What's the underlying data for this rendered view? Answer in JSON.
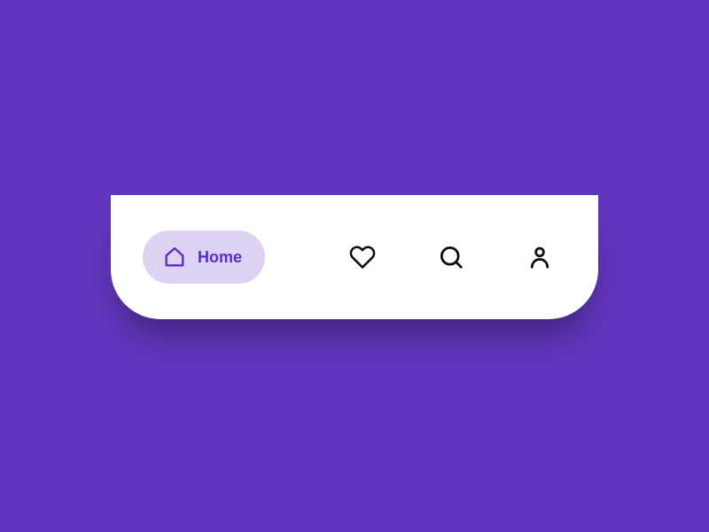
{
  "colors": {
    "background": "#6237c0",
    "nav_background": "#ffffff",
    "active_pill": "#ddd2f2",
    "active_color": "#5a2cc1",
    "icon_color": "#0a0a0a"
  },
  "nav": {
    "items": [
      {
        "id": "home",
        "label": "Home",
        "icon": "home-icon",
        "active": true
      },
      {
        "id": "favorites",
        "label": "Favorites",
        "icon": "heart-icon",
        "active": false
      },
      {
        "id": "search",
        "label": "Search",
        "icon": "search-icon",
        "active": false
      },
      {
        "id": "profile",
        "label": "Profile",
        "icon": "user-icon",
        "active": false
      }
    ]
  }
}
